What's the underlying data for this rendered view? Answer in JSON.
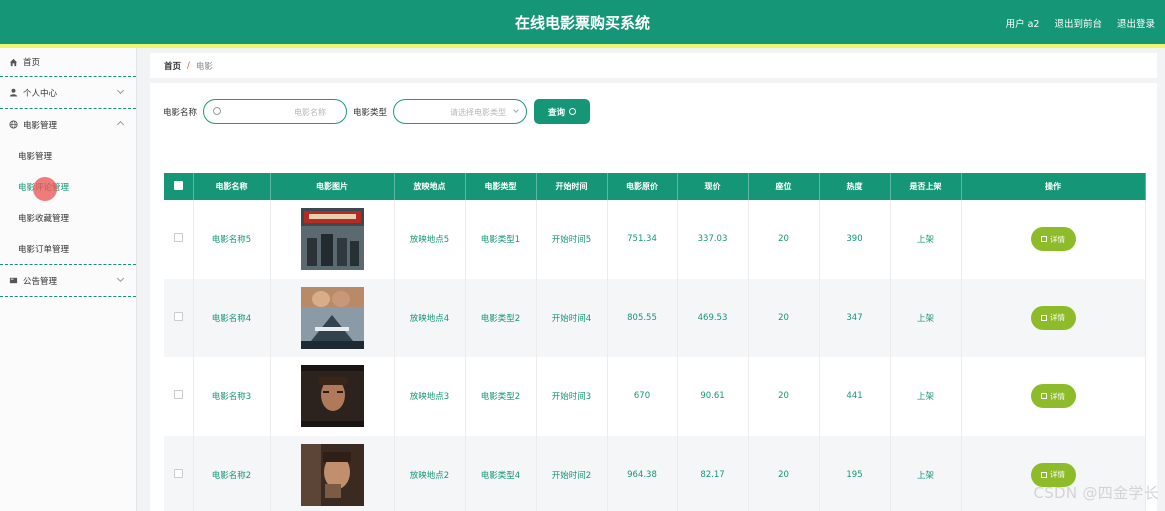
{
  "header": {
    "title": "在线电影票购买系统",
    "links": [
      "用户 a2",
      "退出到前台",
      "退出登录"
    ]
  },
  "sidebar": {
    "items": [
      {
        "label": "首页",
        "icon": "home-icon"
      },
      {
        "label": "个人中心",
        "icon": "user-icon"
      },
      {
        "label": "电影管理",
        "icon": "globe-icon"
      },
      {
        "label": "公告管理",
        "icon": "notice-icon"
      }
    ],
    "submenu": [
      "电影管理",
      "电影评论管理",
      "电影收藏管理",
      "电影订单管理"
    ]
  },
  "breadcrumb": {
    "home": "首页",
    "separator": "/",
    "current": "电影"
  },
  "search": {
    "name_label": "电影名称",
    "name_placeholder": "电影名称",
    "type_label": "电影类型",
    "type_placeholder": "请选择电影类型",
    "query_button": "查询"
  },
  "table": {
    "columns": [
      "电影名称",
      "电影图片",
      "放映地点",
      "电影类型",
      "开始时间",
      "电影原价",
      "现价",
      "座位",
      "热度",
      "是否上架",
      "操作"
    ],
    "rows": [
      {
        "name": "电影名称5",
        "location": "放映地点5",
        "type": "电影类型1",
        "start": "开始时间5",
        "original_price": "751.34",
        "price": "337.03",
        "seats": "20",
        "heat": "390",
        "status": "上架",
        "action": "详情"
      },
      {
        "name": "电影名称4",
        "location": "放映地点4",
        "type": "电影类型2",
        "start": "开始时间4",
        "original_price": "805.55",
        "price": "469.53",
        "seats": "20",
        "heat": "347",
        "status": "上架",
        "action": "详情"
      },
      {
        "name": "电影名称3",
        "location": "放映地点3",
        "type": "电影类型2",
        "start": "开始时间3",
        "original_price": "670",
        "price": "90.61",
        "seats": "20",
        "heat": "441",
        "status": "上架",
        "action": "详情"
      },
      {
        "name": "电影名称2",
        "location": "放映地点2",
        "type": "电影类型4",
        "start": "开始时间2",
        "original_price": "964.38",
        "price": "82.17",
        "seats": "20",
        "heat": "195",
        "status": "上架",
        "action": "详情"
      }
    ]
  },
  "watermark": "CSDN @四金学长",
  "colors": {
    "primary": "#159677",
    "accent_strip": "#f0f56e",
    "detail_button": "#8dbb2a"
  }
}
